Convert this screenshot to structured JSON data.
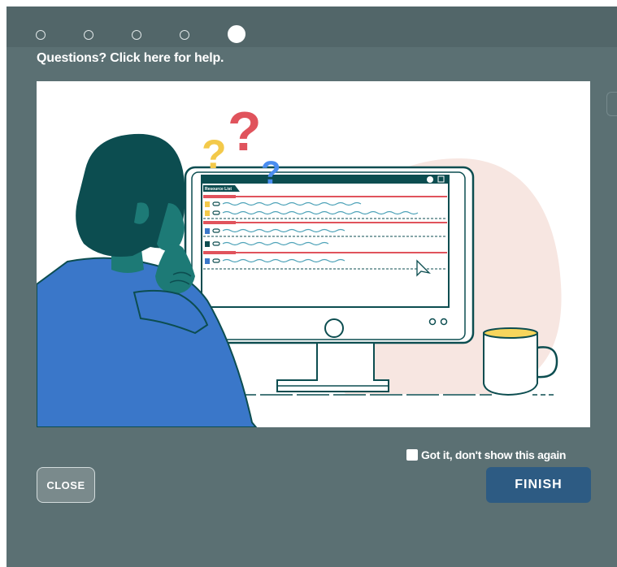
{
  "stepper": {
    "total_steps": 5,
    "current_step": 5
  },
  "help": {
    "label": "Questions? Click here for help."
  },
  "illustration": {
    "screen_title": "Resource List",
    "colors": {
      "teal_dark": "#0c4d50",
      "blue_shirt": "#3a77c9",
      "pink_blob": "#f7e6e1",
      "question_red": "#e0535c",
      "question_yellow": "#f3c94a",
      "question_blue": "#4a8df0",
      "coffee": "#f7d55c"
    }
  },
  "footer": {
    "dont_show_label": "Got it, don't show this again",
    "dont_show_checked": false,
    "close_label": "CLOSE",
    "finish_label": "FINISH"
  },
  "colors": {
    "modal_bg": "#5b7073",
    "finish_bg": "#2d5b83"
  }
}
